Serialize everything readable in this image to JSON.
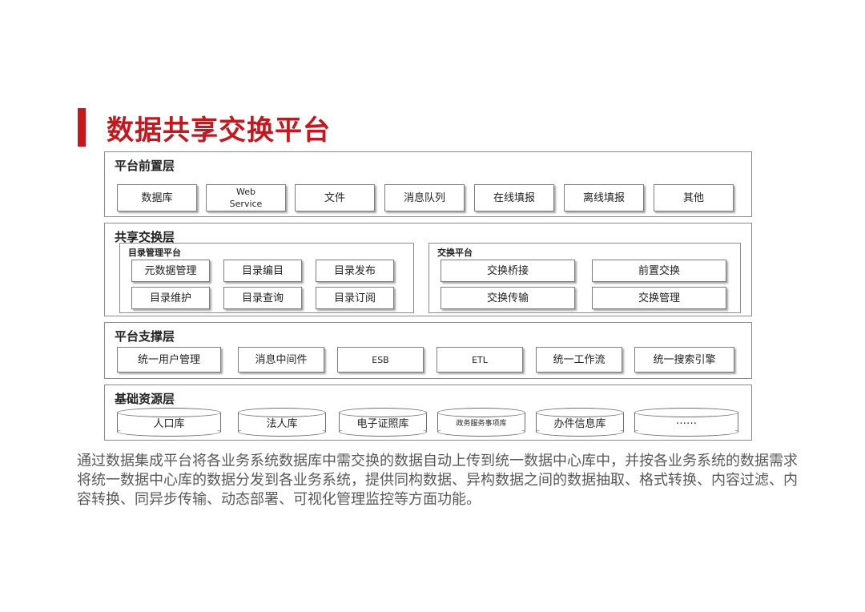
{
  "title": "数据共享交换平台",
  "layers": {
    "front": {
      "title": "平台前置层",
      "items": [
        "数据库",
        "Web",
        "Service",
        "文件",
        "消息队列",
        "在线填报",
        "离线填报",
        "其他"
      ]
    },
    "share": {
      "title": "共享交换层",
      "catalog": {
        "title": "目录管理平台",
        "items": [
          "元数据管理",
          "目录编目",
          "目录发布",
          "目录维护",
          "目录查询",
          "目录订阅"
        ]
      },
      "exchange": {
        "title": "交换平台",
        "items": [
          "交换桥接",
          "前置交换",
          "交换传输",
          "交换管理"
        ]
      }
    },
    "support": {
      "title": "平台支撑层",
      "items": [
        "统一用户管理",
        "消息中间件",
        "ESB",
        "ETL",
        "统一工作流",
        "统一搜索引擎"
      ]
    },
    "base": {
      "title": "基础资源层",
      "items": [
        "人口库",
        "法人库",
        "电子证照库",
        "政务服务事项库",
        "办件信息库",
        "……"
      ]
    }
  },
  "description": "通过数据集成平台将各业务系统数据库中需交换的数据自动上传到统一数据中心库中，并按各业务系统的数据需求将统一数据中心库的数据分发到各业务系统，提供同构数据、异构数据之间的数据抽取、格式转换、内容过滤、内容转换、同异步传输、动态部署、可视化管理监控等方面功能。"
}
